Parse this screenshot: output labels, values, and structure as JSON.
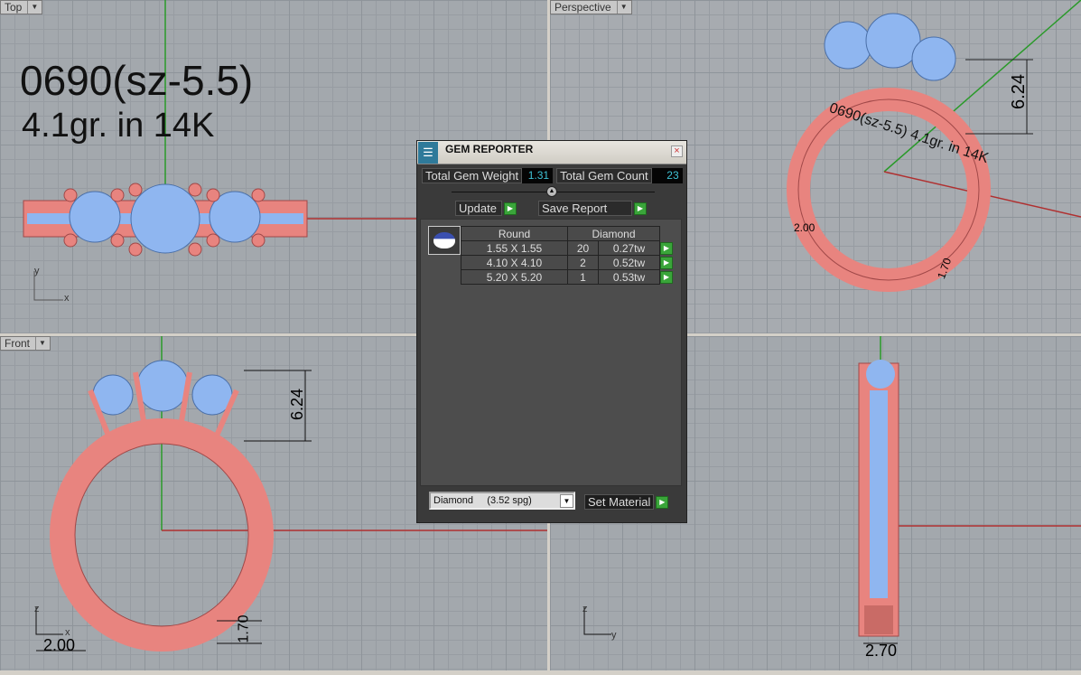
{
  "viewports": {
    "top": {
      "label": "Top",
      "text_line1": "0690(sz-5.5)",
      "text_line2": "4.1gr.  in 14K",
      "axis_x": "x",
      "axis_y": "y"
    },
    "perspective": {
      "label": "Perspective",
      "dim_height": "6.24",
      "dim_width": "2.00",
      "dim_thick": "1.70",
      "engrave": "0690(sz-5.5) 4.1gr. in 14K"
    },
    "front": {
      "label": "Front",
      "dim_height": "6.24",
      "dim_width": "2.00",
      "dim_thick": "1.70",
      "axis_x": "x",
      "axis_y": "z"
    },
    "right": {
      "dim_width": "2.70",
      "axis_x": "y",
      "axis_y": "z"
    }
  },
  "gem_reporter": {
    "title": "GEM REPORTER",
    "close": "×",
    "total_weight_label": "Total Gem Weight",
    "total_weight": "1.31",
    "total_count_label": "Total Gem Count",
    "total_count": "23",
    "update_label": "Update",
    "save_report_label": "Save Report",
    "table": {
      "shape": "Round",
      "material": "Diamond",
      "rows": [
        {
          "size": "1.55 X 1.55",
          "count": "20",
          "weight": "0.27tw"
        },
        {
          "size": "4.10 X 4.10",
          "count": "2",
          "weight": "0.52tw"
        },
        {
          "size": "5.20 X 5.20",
          "count": "1",
          "weight": "0.53tw"
        }
      ]
    },
    "material_select": "Diamond     (3.52 spg)",
    "set_material_label": "Set Material"
  },
  "colors": {
    "metal": "#e8847f",
    "gem": "#8fb6f0",
    "viewport": "#a3a8ad",
    "panel": "#3a3a3a",
    "value": "#3fc3d6",
    "go": "#3aa53a"
  }
}
